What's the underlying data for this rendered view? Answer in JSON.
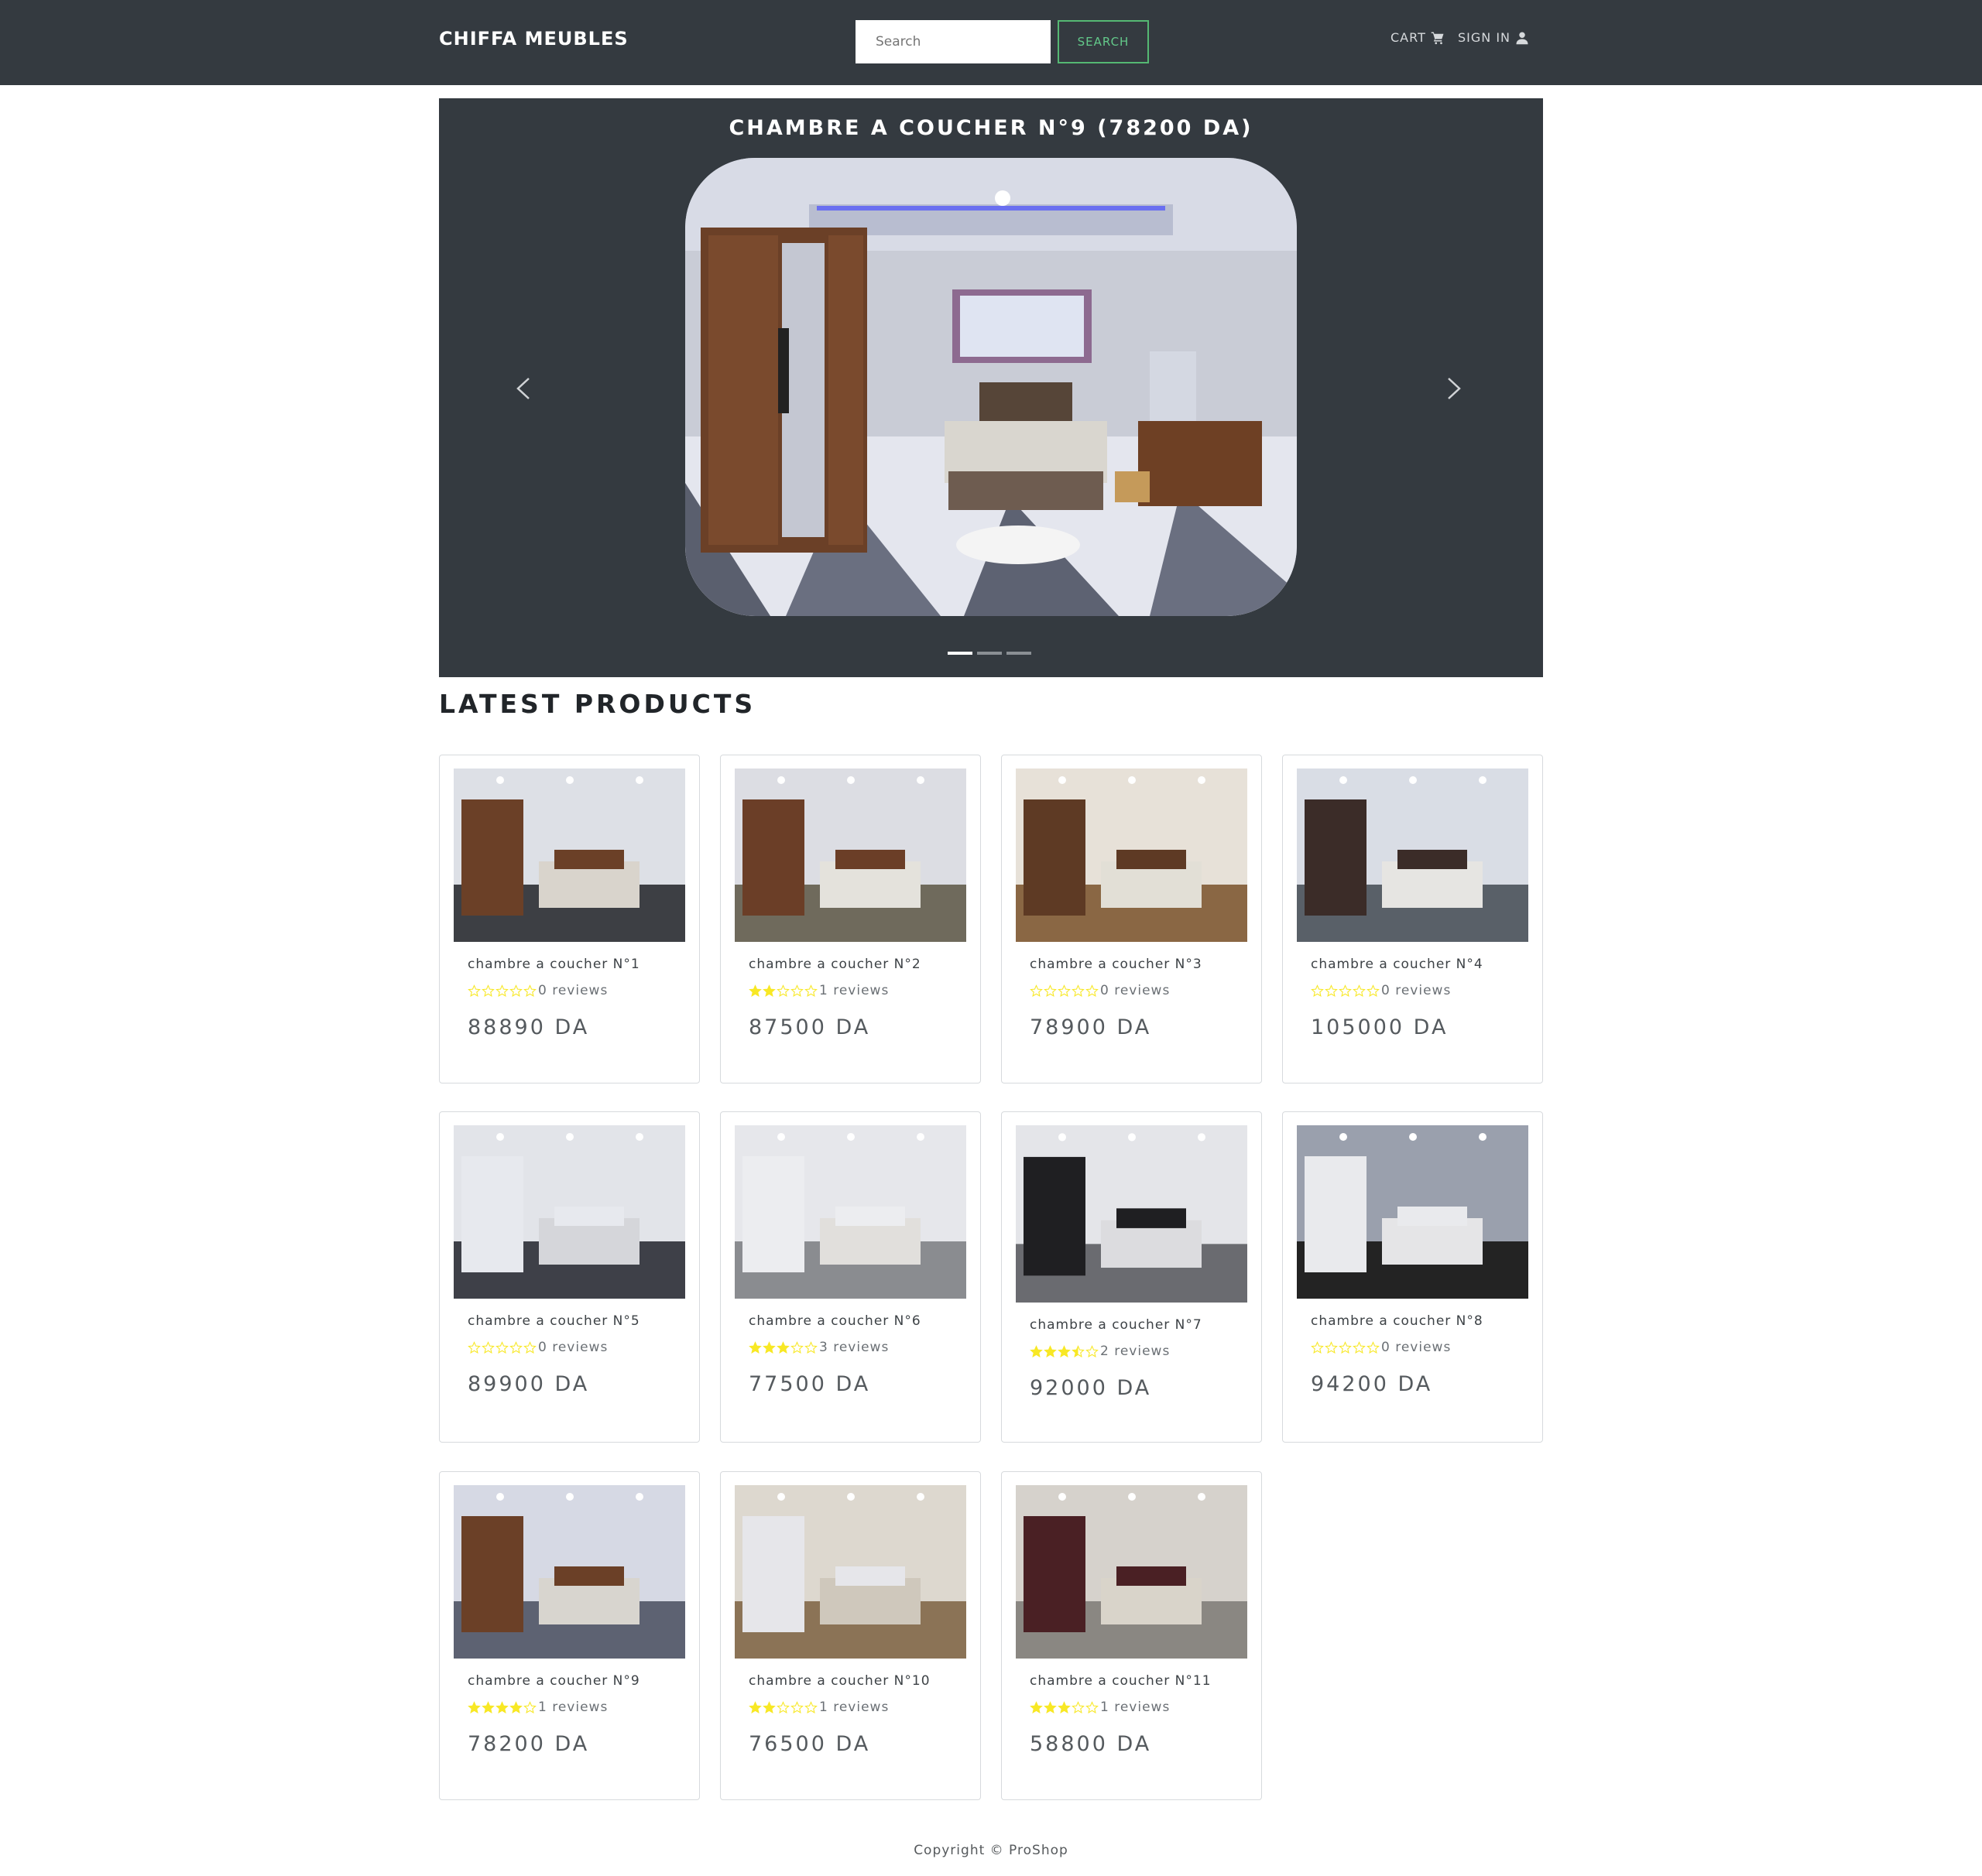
{
  "header": {
    "brand": "CHIFFA MEUBLES",
    "search_placeholder": "Search",
    "search_button": "SEARCH",
    "cart_label": "CART",
    "signin_label": "SIGN IN"
  },
  "carousel": {
    "caption": "CHAMBRE A COUCHER N°9 (78200 DA)",
    "slide_count": 3,
    "active_slide": 1
  },
  "latest": {
    "title": "LATEST PRODUCTS"
  },
  "products": [
    {
      "name": "chambre a coucher N°1",
      "rating": 0,
      "reviews": "0 reviews",
      "price": "88890 DA"
    },
    {
      "name": "chambre a coucher N°2",
      "rating": 2,
      "reviews": "1 reviews",
      "price": "87500 DA"
    },
    {
      "name": "chambre a coucher N°3",
      "rating": 0,
      "reviews": "0 reviews",
      "price": "78900 DA"
    },
    {
      "name": "chambre a coucher N°4",
      "rating": 0,
      "reviews": "0 reviews",
      "price": "105000 DA"
    },
    {
      "name": "chambre a coucher N°5",
      "rating": 0,
      "reviews": "0 reviews",
      "price": "89900 DA"
    },
    {
      "name": "chambre a coucher N°6",
      "rating": 3,
      "reviews": "3 reviews",
      "price": "77500 DA"
    },
    {
      "name": "chambre a coucher N°7",
      "rating": 3.5,
      "reviews": "2 reviews",
      "price": "92000 DA"
    },
    {
      "name": "chambre a coucher N°8",
      "rating": 0,
      "reviews": "0 reviews",
      "price": "94200 DA"
    },
    {
      "name": "chambre a coucher N°9",
      "rating": 4,
      "reviews": "1 reviews",
      "price": "78200 DA"
    },
    {
      "name": "chambre a coucher N°10",
      "rating": 2,
      "reviews": "1 reviews",
      "price": "76500 DA"
    },
    {
      "name": "chambre a coucher N°11",
      "rating": 3,
      "reviews": "1 reviews",
      "price": "58800 DA"
    }
  ],
  "colors": {
    "navbar": "#343a40",
    "star": "#f8e825",
    "search_accent": "#55b873"
  },
  "footer": {
    "text": "Copyright © ProShop"
  }
}
